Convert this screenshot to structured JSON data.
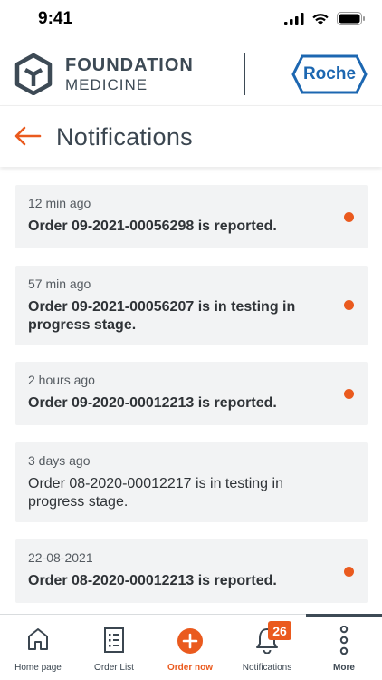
{
  "status_bar": {
    "time": "9:41"
  },
  "brand": {
    "company_line1": "FOUNDATION",
    "company_line2": "MEDICINE",
    "partner": "Roche"
  },
  "header": {
    "title": "Notifications"
  },
  "notifications": [
    {
      "time": "12 min ago",
      "message": "Order 09-2021-00056298 is reported.",
      "unread": true
    },
    {
      "time": "57 min ago",
      "message": "Order 09-2021-00056207 is in testing in progress stage.",
      "unread": true
    },
    {
      "time": "2 hours ago",
      "message": "Order 09-2020-00012213 is reported.",
      "unread": true
    },
    {
      "time": "3 days ago",
      "message": "Order 08-2020-00012217 is in testing in progress stage.",
      "unread": false
    },
    {
      "time": "22-08-2021",
      "message": "Order 08-2020-00012213 is reported.",
      "unread": true
    }
  ],
  "tab_bar": {
    "items": [
      {
        "label": "Home page",
        "icon": "home-icon"
      },
      {
        "label": "Order List",
        "icon": "order-list-icon"
      },
      {
        "label": "Order now",
        "icon": "plus-circle-icon"
      },
      {
        "label": "Notifications",
        "icon": "bell-icon",
        "badge": "26"
      },
      {
        "label": "More",
        "icon": "more-vertical-icon"
      }
    ]
  },
  "colors": {
    "accent": "#ea5a1e",
    "text_dark": "#3b4650",
    "card_bg": "#f2f3f4",
    "roche_blue": "#1c67b1"
  }
}
